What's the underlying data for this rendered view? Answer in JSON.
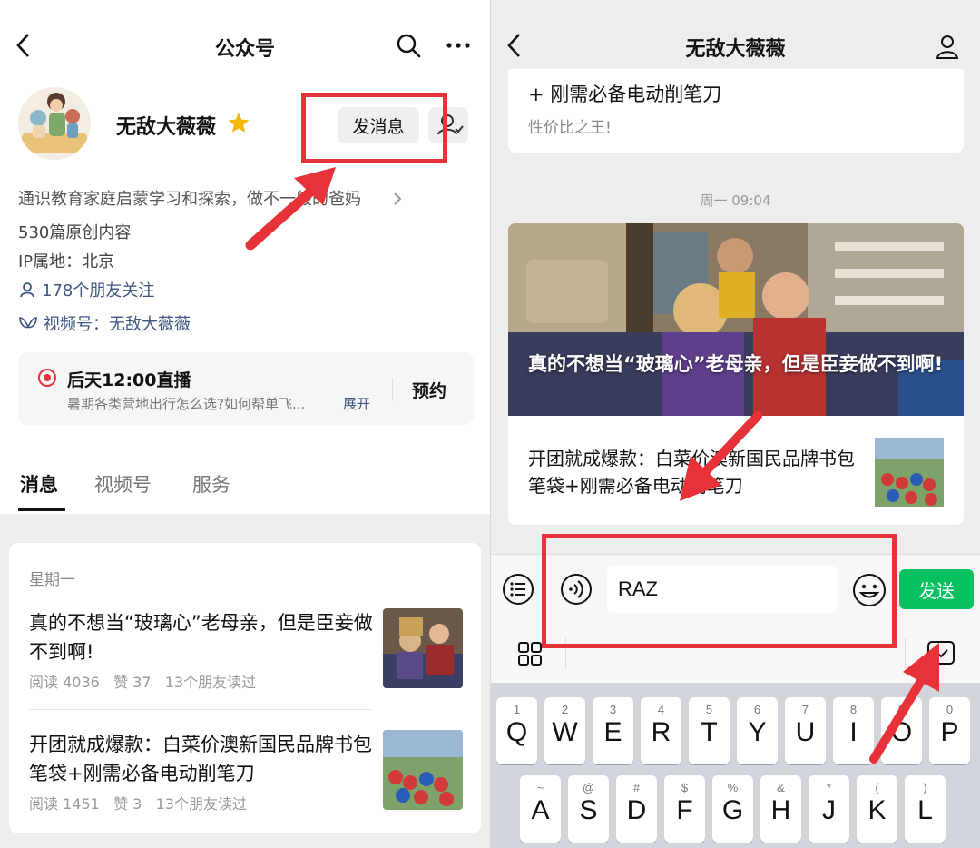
{
  "left": {
    "nav": {
      "title": "公众号"
    },
    "account": {
      "name": "无敌大薇薇",
      "message_button": "发消息",
      "description": "通识教育家庭启蒙学习和探索，做不一般的爸妈",
      "original_count": "530篇原创内容",
      "ip_location": "IP属地：北京",
      "friends_following": "178个朋友关注",
      "video_channel": "视频号：无敌大薇薇"
    },
    "live": {
      "title": "后天12:00直播",
      "subtitle": "暑期各类营地出行怎么选?如何帮单飞...",
      "expand": "展开",
      "book_button": "预约"
    },
    "tabs": [
      {
        "label": "消息",
        "active": true
      },
      {
        "label": "视频号",
        "active": false
      },
      {
        "label": "服务",
        "active": false
      }
    ],
    "feed": {
      "day": "星期一",
      "articles": [
        {
          "title": "真的不想当“玻璃心”老母亲，但是臣妾做不到啊!",
          "reads": "阅读 4036",
          "likes": "赞 37",
          "friends_read": "13个朋友读过"
        },
        {
          "title": "开团就成爆款：白菜价澳新国民品牌书包笔袋+刚需必备电动削笔刀",
          "reads": "阅读 1451",
          "likes": "赞 3",
          "friends_read": "13个朋友读过"
        }
      ]
    }
  },
  "right": {
    "nav": {
      "title": "无敌大薇薇"
    },
    "previous_card": {
      "title": "+ 刚需必备电动削笔刀",
      "subtitle": "性价比之王!"
    },
    "timestamp": "周一 09:04",
    "news": {
      "caption": "真的不想当“玻璃心”老母亲，但是臣妾做不到啊!",
      "sub_title": "开团就成爆款：白菜价澳新国民品牌书包笔袋+刚需必备电动削笔刀"
    },
    "input": {
      "value": "RAZ",
      "send_button": "发送"
    },
    "keyboard": {
      "row1": [
        {
          "num": "1",
          "char": "Q"
        },
        {
          "num": "2",
          "char": "W"
        },
        {
          "num": "3",
          "char": "E"
        },
        {
          "num": "4",
          "char": "R"
        },
        {
          "num": "5",
          "char": "T"
        },
        {
          "num": "6",
          "char": "Y"
        },
        {
          "num": "7",
          "char": "U"
        },
        {
          "num": "8",
          "char": "I"
        },
        {
          "num": "9",
          "char": "O"
        },
        {
          "num": "0",
          "char": "P"
        }
      ],
      "row2": [
        {
          "num": "~",
          "char": "A"
        },
        {
          "num": "@",
          "char": "S"
        },
        {
          "num": "#",
          "char": "D"
        },
        {
          "num": "$",
          "char": "F"
        },
        {
          "num": "%",
          "char": "G"
        },
        {
          "num": "&",
          "char": "H"
        },
        {
          "num": "*",
          "char": "J"
        },
        {
          "num": "(",
          "char": "K"
        },
        {
          "num": ")",
          "char": "L"
        }
      ]
    }
  },
  "colors": {
    "highlight": "#e8323a",
    "send_green": "#07c160",
    "link_blue": "#3e5680",
    "star": "#f5b800"
  }
}
